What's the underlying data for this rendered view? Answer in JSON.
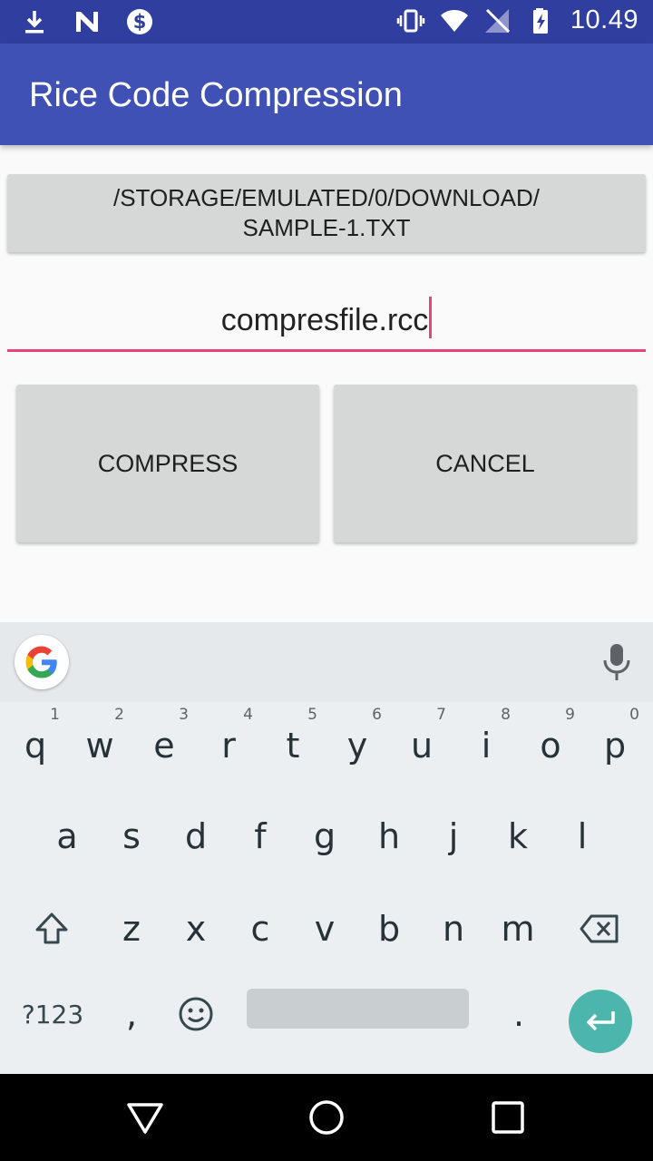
{
  "status_bar": {
    "time": "10.49",
    "icons_left": [
      "download-icon",
      "n-app-icon",
      "dollar-icon"
    ],
    "icons_right": [
      "vibrate-icon",
      "wifi-icon",
      "no-signal-icon",
      "battery-charging-icon"
    ]
  },
  "app_bar": {
    "title": "Rice Code Compression"
  },
  "content": {
    "path_button_line1": "/STORAGE/EMULATED/0/DOWNLOAD/",
    "path_button_line2": "SAMPLE-1.TXT",
    "filename_value": "compresfile.rcc",
    "compress_label": "COMPRESS",
    "cancel_label": "CANCEL",
    "accent_color": "#e6437a"
  },
  "keyboard": {
    "row1": [
      {
        "key": "q",
        "hint": "1"
      },
      {
        "key": "w",
        "hint": "2"
      },
      {
        "key": "e",
        "hint": "3"
      },
      {
        "key": "r",
        "hint": "4"
      },
      {
        "key": "t",
        "hint": "5"
      },
      {
        "key": "y",
        "hint": "6"
      },
      {
        "key": "u",
        "hint": "7"
      },
      {
        "key": "i",
        "hint": "8"
      },
      {
        "key": "o",
        "hint": "9"
      },
      {
        "key": "p",
        "hint": "0"
      }
    ],
    "row2": [
      "a",
      "s",
      "d",
      "f",
      "g",
      "h",
      "j",
      "k",
      "l"
    ],
    "row3": [
      "z",
      "x",
      "c",
      "v",
      "b",
      "n",
      "m"
    ],
    "symbols_label": "?123",
    "comma_label": ",",
    "period_label": "."
  },
  "colors": {
    "status_bar": "#303f9f",
    "app_bar": "#3f51b5",
    "enter_key": "#4db6ac"
  }
}
